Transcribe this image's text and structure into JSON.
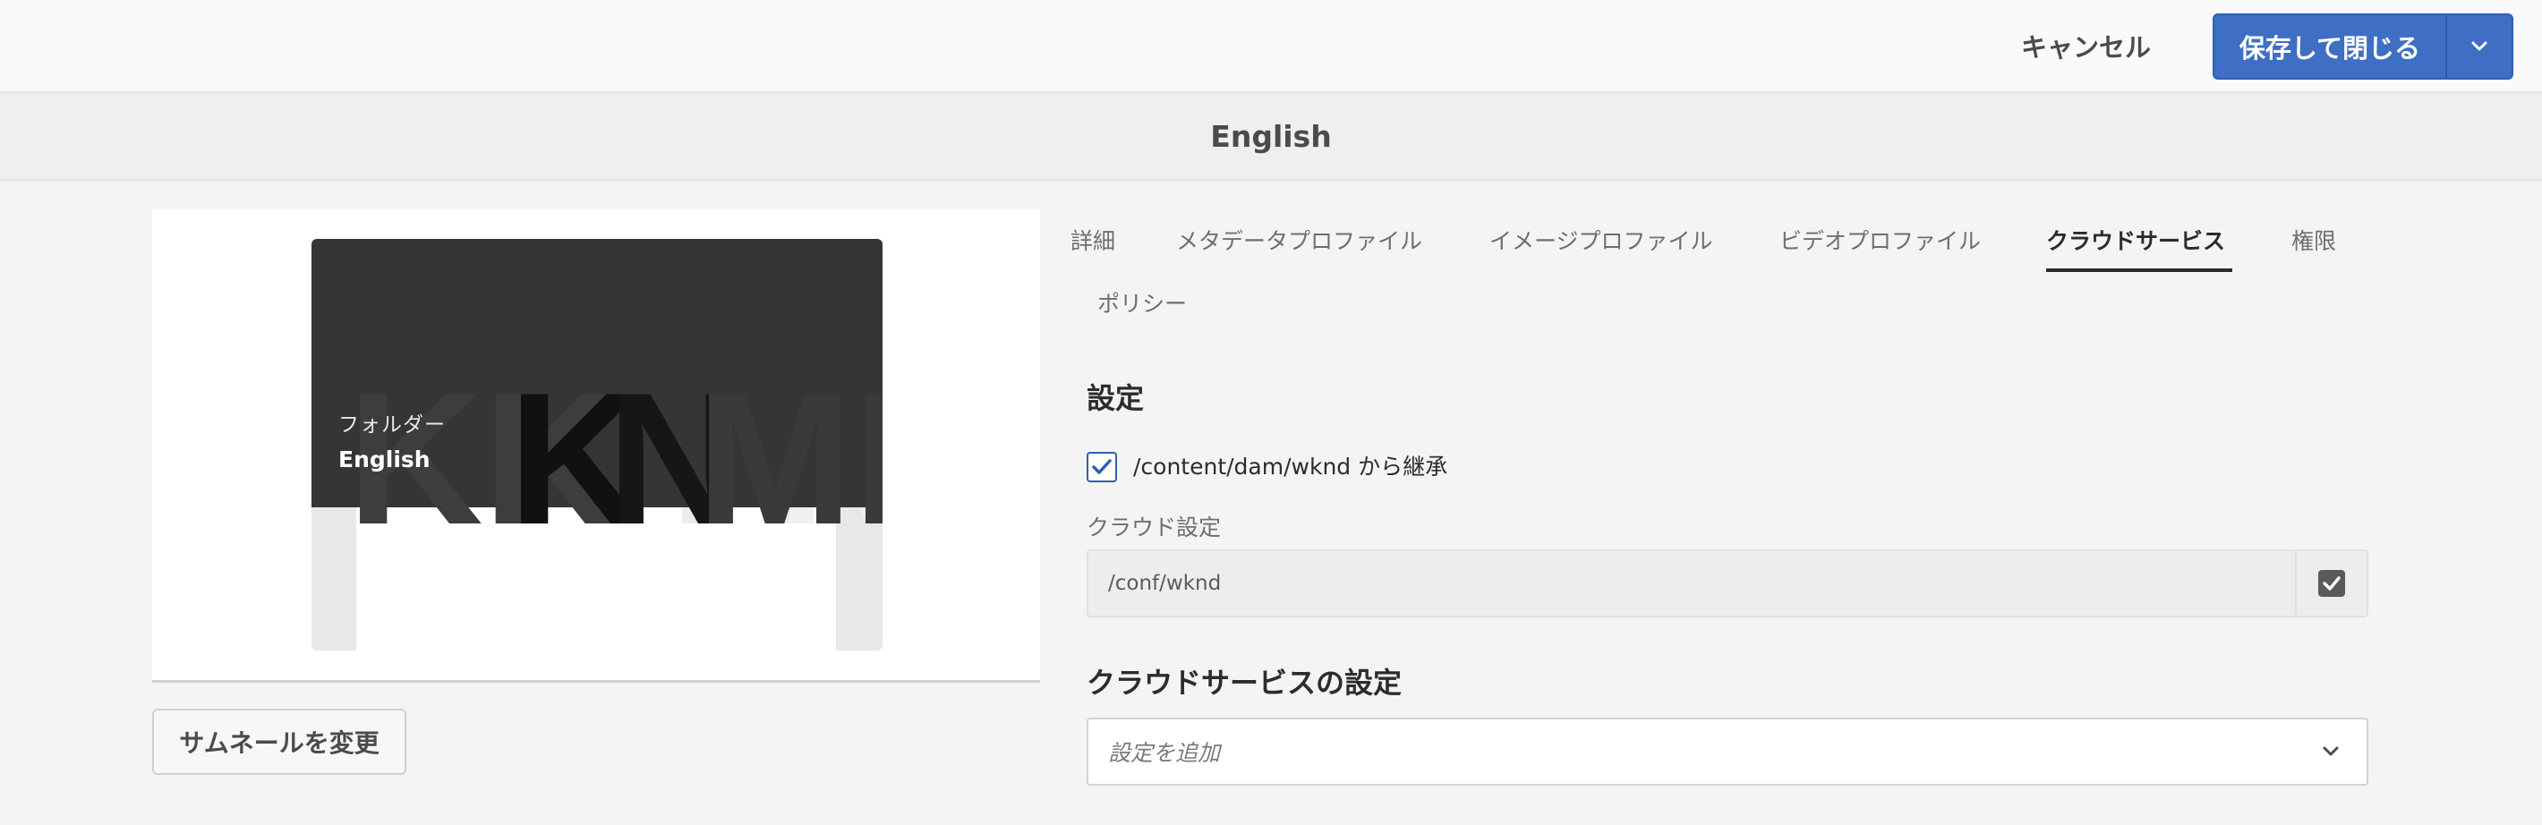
{
  "toolbar": {
    "cancel_label": "キャンセル",
    "save_label": "保存して閉じる",
    "save_dropdown_icon": "chevron-down-icon",
    "accent": "#3e6fc4"
  },
  "header": {
    "title": "English"
  },
  "preview": {
    "kind_label": "フォルダー",
    "name": "English",
    "change_thumbnail_label": "サムネールを変更"
  },
  "tabs": [
    {
      "label": "詳細",
      "active": false
    },
    {
      "label": "メタデータプロファイル",
      "active": false
    },
    {
      "label": "イメージプロファイル",
      "active": false
    },
    {
      "label": "ビデオプロファイル",
      "active": false
    },
    {
      "label": "クラウドサービス",
      "active": true
    },
    {
      "label": "権限",
      "active": false
    },
    {
      "label": "ポリシー",
      "active": false
    }
  ],
  "settings": {
    "heading": "設定",
    "inherit_checked": true,
    "inherit_label": "/content/dam/wknd から継承",
    "cloud_config_label": "クラウド設定",
    "cloud_config_value": "/conf/wknd",
    "cloud_config_checked": true
  },
  "cloud_services": {
    "heading": "クラウドサービスの設定",
    "add_placeholder": "設定を追加"
  }
}
